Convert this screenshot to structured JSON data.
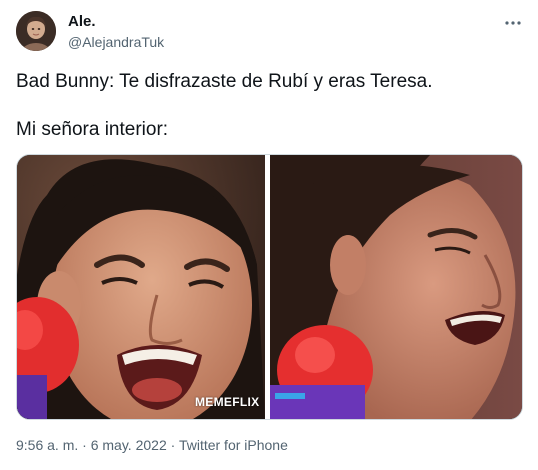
{
  "author": {
    "name": "Ale.",
    "handle": "@AlejandraTuk"
  },
  "tweet": {
    "line1": "Bad Bunny: Te disfrazaste de Rubí y eras Teresa.",
    "line2": "Mi señora interior:"
  },
  "media": {
    "watermark": "MEMEFLIX",
    "left_image": "woman-laughing-with-microphone",
    "right_image": "woman-laughing-profile-with-microphone"
  },
  "meta": {
    "time": "9:56 a. m.",
    "separator": "·",
    "date": "6 may. 2022",
    "source": "Twitter for iPhone"
  },
  "icons": {
    "more": "more-horizontal-icon"
  },
  "colors": {
    "text": "#0f1419",
    "secondary": "#536471",
    "border": "#cfd9de"
  }
}
